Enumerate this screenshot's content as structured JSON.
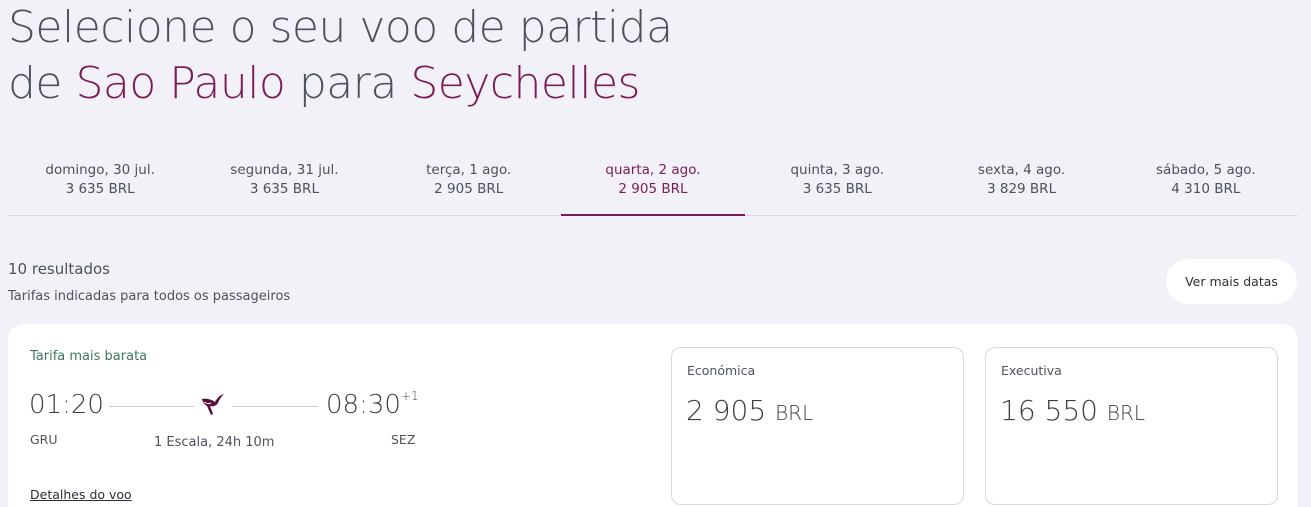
{
  "header": {
    "title_line1": "Selecione o seu voo de partida",
    "title_de": "de",
    "origin": "Sao Paulo",
    "title_para": "para",
    "destination": "Seychelles"
  },
  "dates": [
    {
      "day": "domingo, 30 jul.",
      "price": "3 635 BRL"
    },
    {
      "day": "segunda, 31 jul.",
      "price": "3 635 BRL"
    },
    {
      "day": "terça, 1 ago.",
      "price": "2 905 BRL"
    },
    {
      "day": "quarta, 2 ago.",
      "price": "2 905 BRL"
    },
    {
      "day": "quinta, 3 ago.",
      "price": "3 635 BRL"
    },
    {
      "day": "sexta, 4 ago.",
      "price": "3 829 BRL"
    },
    {
      "day": "sábado, 5 ago.",
      "price": "4 310 BRL"
    }
  ],
  "results": {
    "count": "10 resultados",
    "note": "Tarifas indicadas para todos os passageiros",
    "more_dates": "Ver mais datas"
  },
  "flight": {
    "tag": "Tarifa mais barata",
    "dep_time": "01:20",
    "arr_time": "08:30",
    "arr_offset": "+1",
    "dep_code": "GRU",
    "arr_code": "SEZ",
    "stops": "1 Escala, 24h 10m",
    "details": "Detalhes do voo",
    "airline_icon": "qatar-oryx-logo-icon",
    "fares": [
      {
        "label": "Económica",
        "amount": "2 905",
        "currency": "BRL"
      },
      {
        "label": "Executiva",
        "amount": "16 550",
        "currency": "BRL"
      }
    ]
  },
  "colors": {
    "accent": "#7a1d55",
    "green": "#3d7a57",
    "background": "#f1f1f7"
  }
}
